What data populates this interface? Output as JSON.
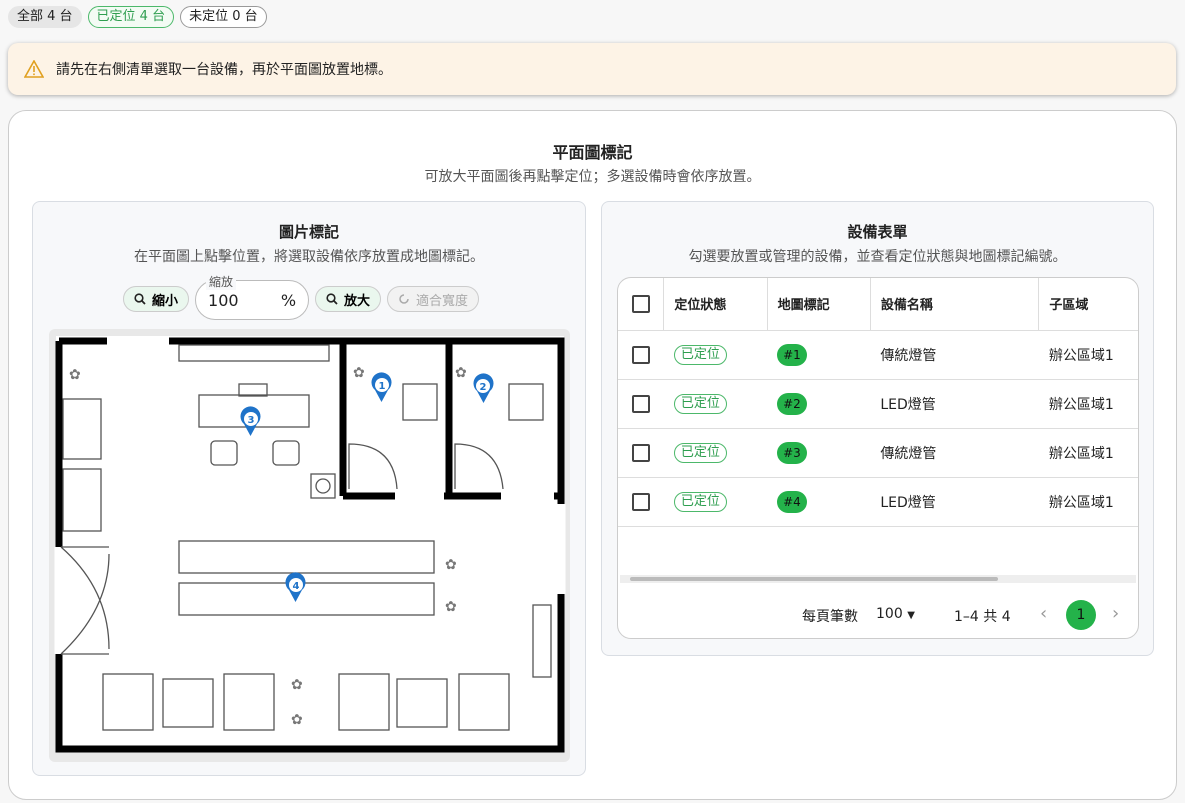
{
  "filters": {
    "all": "全部 4 台",
    "located": "已定位 4 台",
    "unlocated": "未定位 0 台"
  },
  "alert": {
    "text": "請先在右側清單選取一台設備，再於平面圖放置地標。"
  },
  "card": {
    "title": "平面圖標記",
    "subtitle": "可放大平面圖後再點擊定位；多選設備時會依序放置。"
  },
  "left": {
    "title": "圖片標記",
    "subtitle": "在平面圖上點擊位置，將選取設備依序放置成地圖標記。",
    "zoom_out": "縮小",
    "zoom_label": "縮放",
    "zoom_value": "100",
    "zoom_unit": "%",
    "zoom_in": "放大",
    "fit_width": "適合寬度",
    "markers": [
      "1",
      "2",
      "3",
      "4"
    ]
  },
  "right": {
    "title": "設備表單",
    "subtitle": "勾選要放置或管理的設備，並查看定位狀態與地圖標記編號。",
    "columns": [
      "定位狀態",
      "地圖標記",
      "設備名稱",
      "子區域"
    ],
    "rows": [
      {
        "status": "已定位",
        "tag": "#1",
        "name": "傳統燈管",
        "area": "辦公區域1"
      },
      {
        "status": "已定位",
        "tag": "#2",
        "name": "LED燈管",
        "area": "辦公區域1"
      },
      {
        "status": "已定位",
        "tag": "#3",
        "name": "傳統燈管",
        "area": "辦公區域1"
      },
      {
        "status": "已定位",
        "tag": "#4",
        "name": "LED燈管",
        "area": "辦公區域1"
      }
    ],
    "pager": {
      "rows_per_page_label": "每頁筆數",
      "rows_per_page": "100",
      "range": "1–4 共 4",
      "page": "1"
    }
  }
}
